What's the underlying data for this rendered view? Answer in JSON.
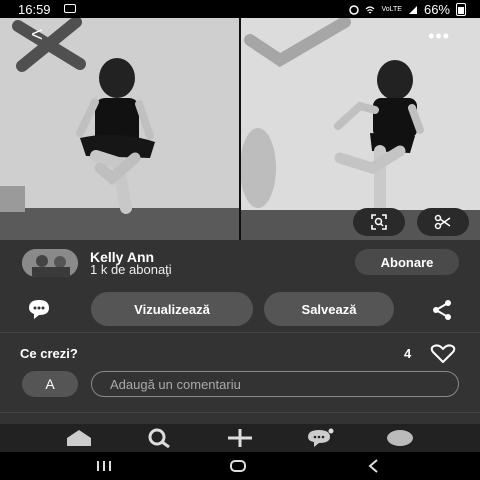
{
  "status_bar": {
    "time": "16:59",
    "network": "VoLTE",
    "battery": "66%"
  },
  "creator": {
    "name": "Kelly Ann",
    "followers": "1 k de abonaţi",
    "follow_label": "Abonare"
  },
  "actions": {
    "visualize_label": "Vizualizează",
    "save_label": "Salvează"
  },
  "comments": {
    "question": "Ce crezi?",
    "likes": "4",
    "avatar_letter": "A",
    "placeholder": "Adaugă un comentariu"
  },
  "icons": {
    "back": "back-arrow-icon",
    "more": "more-icon",
    "lens": "visual-search-icon",
    "cut": "scissors-icon",
    "comment": "comment-icon",
    "share": "share-icon",
    "heart": "heart-icon",
    "home": "home-icon",
    "search": "search-icon",
    "create": "plus-icon",
    "messages": "messages-icon",
    "profile": "profile-icon"
  }
}
